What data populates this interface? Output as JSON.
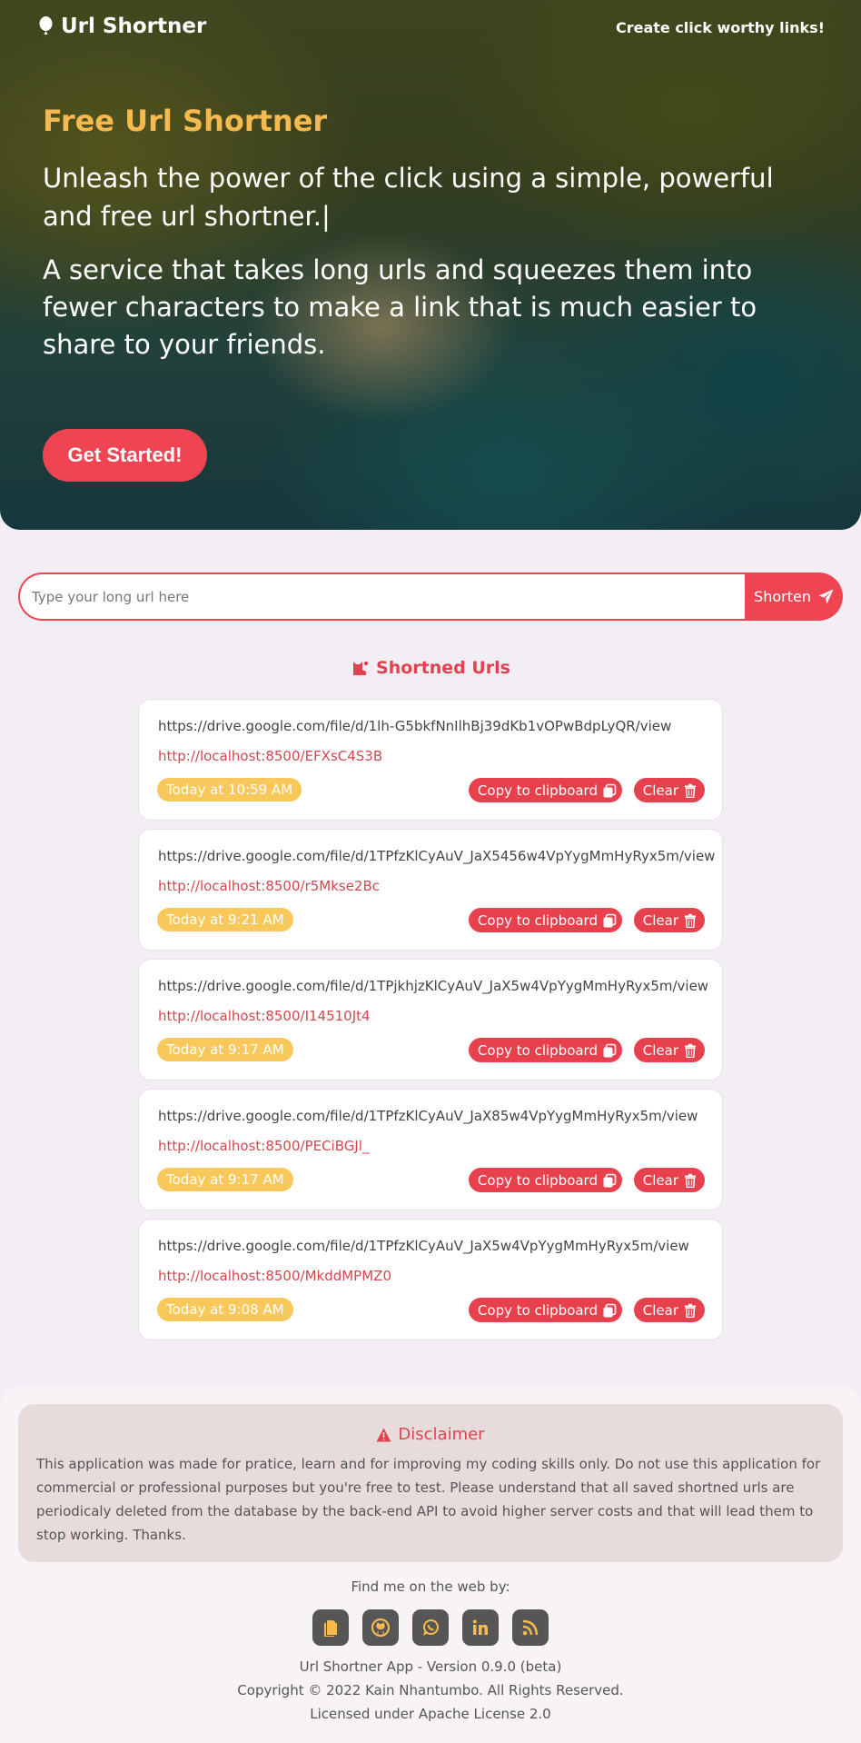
{
  "header": {
    "brand": "Url Shortner",
    "tagline": "Create click worthy links!"
  },
  "hero": {
    "title": "Free Url Shortner",
    "subtitle": "Unleash the power of the click using a simple, powerful and free url shortner.|",
    "description": "A service that takes long urls and squeezes them into fewer characters to make a link that is much easier to share to your friends.",
    "cta_label": "Get Started!"
  },
  "form": {
    "placeholder": "Type your long url here",
    "value": "",
    "button_label": "Shorten"
  },
  "list": {
    "title": "Shortned Urls",
    "copy_label": "Copy to clipboard",
    "clear_label": "Clear",
    "items": [
      {
        "long_url": "https://drive.google.com/file/d/1lh-G5bkfNnIlhBj39dKb1vOPwBdpLyQR/view",
        "short_url": "http://localhost:8500/EFXsC4S3B",
        "time": "Today at 10:59 AM"
      },
      {
        "long_url": "https://drive.google.com/file/d/1TPfzKlCyAuV_JaX5456w4VpYygMmHyRyx5m/view",
        "short_url": "http://localhost:8500/r5Mkse2Bc",
        "time": "Today at 9:21 AM"
      },
      {
        "long_url": "https://drive.google.com/file/d/1TPjkhjzKlCyAuV_JaX5w4VpYygMmHyRyx5m/view",
        "short_url": "http://localhost:8500/I14510Jt4",
        "time": "Today at 9:17 AM"
      },
      {
        "long_url": "https://drive.google.com/file/d/1TPfzKlCyAuV_JaX85w4VpYygMmHyRyx5m/view",
        "short_url": "http://localhost:8500/PECiBGJl_",
        "time": "Today at 9:17 AM"
      },
      {
        "long_url": "https://drive.google.com/file/d/1TPfzKlCyAuV_JaX5w4VpYygMmHyRyx5m/view",
        "short_url": "http://localhost:8500/MkddMPMZ0",
        "time": "Today at 9:08 AM"
      }
    ]
  },
  "disclaimer": {
    "title": "Disclaimer",
    "text": "This application was made for pratice, learn and for improving my coding skills only. Do not use this application for commercial or professional purposes but you're free to test. Please understand that all saved shortned urls are periodicaly deleted from the database by the back-end API to avoid higher server costs and that will lead them to stop working. Thanks."
  },
  "footer": {
    "find_me": "Find me on the web by:",
    "socials": [
      "document-icon",
      "github-icon",
      "whatsapp-icon",
      "linkedin-icon",
      "rss-icon"
    ],
    "version": "Url Shortner App - Version 0.9.0 (beta)",
    "copyright": "Copyright © 2022 Kain Nhantumbo. All Rights Reserved.",
    "license": "Licensed under Apache License 2.0"
  },
  "colors": {
    "accent": "#ef4452",
    "gold": "#f5b94e",
    "badge": "#f8c85a",
    "background": "#f3eef4"
  }
}
